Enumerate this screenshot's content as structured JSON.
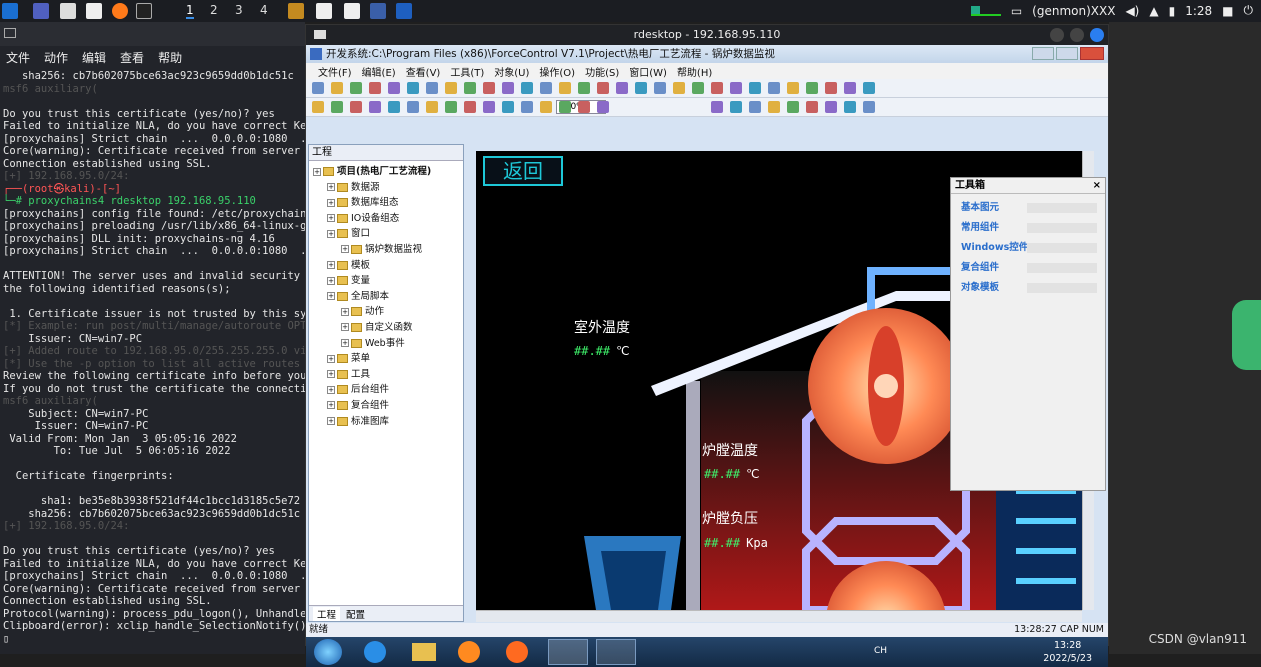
{
  "topbar": {
    "workspaces": [
      "1",
      "2",
      "3",
      "4"
    ],
    "user": "(genmon)XXX",
    "clock": "1:28"
  },
  "terminal": {
    "menu": [
      "文件",
      "动作",
      "编辑",
      "查看",
      "帮助"
    ],
    "lines": [
      {
        "t": "   sha256: cb7b602075bce63ac923c9659dd0b1dc51c",
        "c": ""
      },
      {
        "t": "msf6 auxiliary(",
        "c": "faint"
      },
      {
        "t": "",
        "c": ""
      },
      {
        "t": "Do you trust this certificate (yes/no)? yes",
        "c": ""
      },
      {
        "t": "Failed to initialize NLA, do you have correct Ke",
        "c": ""
      },
      {
        "t": "[proxychains] Strict chain  ...  0.0.0.0:1080  .",
        "c": ""
      },
      {
        "t": "Core(warning): Certificate received from server",
        "c": ""
      },
      {
        "t": "Connection established using SSL.",
        "c": ""
      },
      {
        "t": "[+] 192.168.95.0/24:",
        "c": "faint"
      },
      {
        "t": "┌──(root㉿kali)-[~]",
        "c": "red"
      },
      {
        "t": "└─# proxychains4 rdesktop 192.168.95.110",
        "c": "grn"
      },
      {
        "t": "[proxychains] config file found: /etc/proxychain",
        "c": ""
      },
      {
        "t": "[proxychains] preloading /usr/lib/x86_64-linux-g",
        "c": ""
      },
      {
        "t": "[proxychains] DLL init: proxychains-ng 4.16",
        "c": ""
      },
      {
        "t": "[proxychains] Strict chain  ...  0.0.0.0:1080  .",
        "c": ""
      },
      {
        "t": "",
        "c": ""
      },
      {
        "t": "ATTENTION! The server uses and invalid security",
        "c": ""
      },
      {
        "t": "the following identified reasons(s);",
        "c": ""
      },
      {
        "t": "",
        "c": ""
      },
      {
        "t": " 1. Certificate issuer is not trusted by this sy",
        "c": ""
      },
      {
        "t": "[*] Example: run post/multi/manage/autoroute OPT",
        "c": "faint"
      },
      {
        "t": "    Issuer: CN=win7-PC",
        "c": ""
      },
      {
        "t": "[+] Added route to 192.168.95.0/255.255.255.0 vi",
        "c": "faint"
      },
      {
        "t": "[*] Use the -p option to list all active routes",
        "c": "faint"
      },
      {
        "t": "Review the following certificate info before you",
        "c": ""
      },
      {
        "t": "If you do not trust the certificate the connecti",
        "c": ""
      },
      {
        "t": "msf6 auxiliary(",
        "c": "faint"
      },
      {
        "t": "    Subject: CN=win7-PC",
        "c": ""
      },
      {
        "t": "     Issuer: CN=win7-PC",
        "c": ""
      },
      {
        "t": " Valid From: Mon Jan  3 05:05:16 2022",
        "c": ""
      },
      {
        "t": "        To: Tue Jul  5 06:05:16 2022",
        "c": ""
      },
      {
        "t": "",
        "c": ""
      },
      {
        "t": "  Certificate fingerprints:",
        "c": ""
      },
      {
        "t": "",
        "c": ""
      },
      {
        "t": "      sha1: be35e8b3938f521df44c1bcc1d3185c5e72",
        "c": ""
      },
      {
        "t": "    sha256: cb7b602075bce63ac923c9659dd0b1dc51c",
        "c": ""
      },
      {
        "t": "[+] 192.168.95.0/24:",
        "c": "faint"
      },
      {
        "t": "",
        "c": ""
      },
      {
        "t": "Do you trust this certificate (yes/no)? yes",
        "c": ""
      },
      {
        "t": "Failed to initialize NLA, do you have correct Ke",
        "c": ""
      },
      {
        "t": "[proxychains] Strict chain  ...  0.0.0.0:1080  .",
        "c": ""
      },
      {
        "t": "Core(warning): Certificate received from server",
        "c": ""
      },
      {
        "t": "Connection established using SSL.",
        "c": ""
      },
      {
        "t": "Protocol(warning): process_pdu_logon(), Unhandle",
        "c": ""
      },
      {
        "t": "Clipboard(error): xclip_handle_SelectionNotify()",
        "c": ""
      },
      {
        "t": "▯",
        "c": ""
      }
    ]
  },
  "rdp": {
    "window_title": "rdesktop - 192.168.95.110",
    "app_title": "开发系统:C:\\Program Files (x86)\\ForceControl V7.1\\Project\\热电厂工艺流程 - 锅炉数据监视",
    "menu": [
      "文件(F)",
      "编辑(E)",
      "查看(V)",
      "工具(T)",
      "对象(U)",
      "操作(O)",
      "功能(S)",
      "窗口(W)",
      "帮助(H)"
    ],
    "zoom": "100%",
    "project_panel": {
      "title": "工程",
      "nodes": [
        {
          "label": "项目(热电厂工艺流程)",
          "level": 0,
          "bold": true
        },
        {
          "label": "数据源",
          "level": 1
        },
        {
          "label": "数据库组态",
          "level": 1
        },
        {
          "label": "IO设备组态",
          "level": 1
        },
        {
          "label": "窗口",
          "level": 1
        },
        {
          "label": "锅炉数据监视",
          "level": 2
        },
        {
          "label": "模板",
          "level": 1
        },
        {
          "label": "变量",
          "level": 1
        },
        {
          "label": "全局脚本",
          "level": 1
        },
        {
          "label": "动作",
          "level": 2
        },
        {
          "label": "自定义函数",
          "level": 2
        },
        {
          "label": "Web事件",
          "level": 2
        },
        {
          "label": "菜单",
          "level": 1
        },
        {
          "label": "工具",
          "level": 1
        },
        {
          "label": "后台组件",
          "level": 1
        },
        {
          "label": "复合组件",
          "level": 1
        },
        {
          "label": "标准图库",
          "level": 1
        }
      ],
      "tabs": [
        "工程",
        "配置"
      ]
    },
    "scene": {
      "back": "返回",
      "outdoor_temp_label": "室外温度",
      "outdoor_temp_value": "##.##",
      "outdoor_temp_unit": "℃",
      "furnace_temp_label": "炉膛温度",
      "furnace_temp_value": "##.##",
      "furnace_temp_unit": "℃",
      "furnace_press_label": "炉膛负压",
      "furnace_press_value": "##.##",
      "furnace_press_unit": "Kpa"
    },
    "toolbox": {
      "title": "工具箱",
      "items": [
        "基本图元",
        "常用组件",
        "Windows控件",
        "复合组件",
        "对象模板"
      ]
    },
    "status": {
      "left": "就绪",
      "time": "13:28:27",
      "caps": "CAP",
      "num": "NUM"
    },
    "win_taskbar": {
      "lang": "CH",
      "time": "13:28",
      "date": "2022/5/23"
    }
  },
  "watermark": "CSDN @vlan911"
}
